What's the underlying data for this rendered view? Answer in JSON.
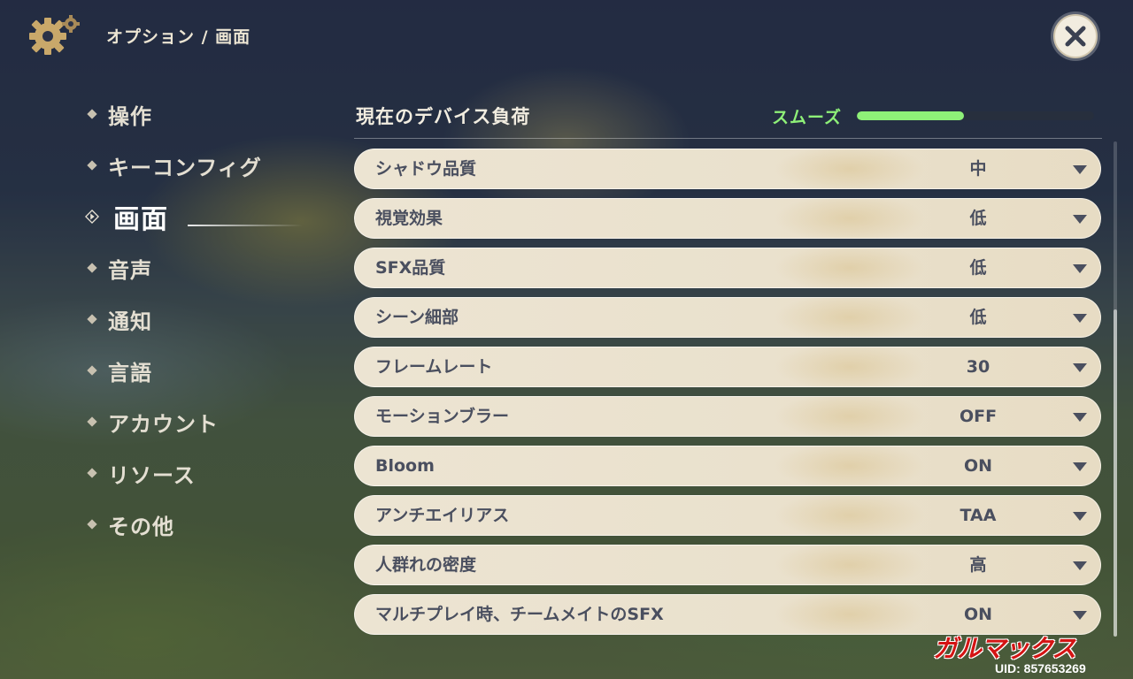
{
  "header": {
    "breadcrumb": "オプション / 画面",
    "close_icon": "close-x-icon",
    "settings_icon": "gear-icon"
  },
  "sidebar": {
    "items": [
      {
        "label": "操作",
        "active": false
      },
      {
        "label": "キーコンフィグ",
        "active": false
      },
      {
        "label": "画面",
        "active": true
      },
      {
        "label": "音声",
        "active": false
      },
      {
        "label": "通知",
        "active": false
      },
      {
        "label": "言語",
        "active": false
      },
      {
        "label": "アカウント",
        "active": false
      },
      {
        "label": "リソース",
        "active": false
      },
      {
        "label": "その他",
        "active": false
      }
    ]
  },
  "device_load": {
    "title": "現在のデバイス負荷",
    "status": "スムーズ",
    "level": 0.45,
    "status_color": "#8ef078"
  },
  "settings": [
    {
      "label": "シャドウ品質",
      "value": "中"
    },
    {
      "label": "視覚効果",
      "value": "低"
    },
    {
      "label": "SFX品質",
      "value": "低"
    },
    {
      "label": "シーン細部",
      "value": "低"
    },
    {
      "label": "フレームレート",
      "value": "30"
    },
    {
      "label": "モーションブラー",
      "value": "OFF"
    },
    {
      "label": "Bloom",
      "value": "ON"
    },
    {
      "label": "アンチエイリアス",
      "value": "TAA"
    },
    {
      "label": "人群れの密度",
      "value": "高"
    },
    {
      "label": "マルチプレイ時、チームメイトのSFX",
      "value": "ON"
    }
  ],
  "watermark": "ガルマックス",
  "uid": "UID: 857653269"
}
